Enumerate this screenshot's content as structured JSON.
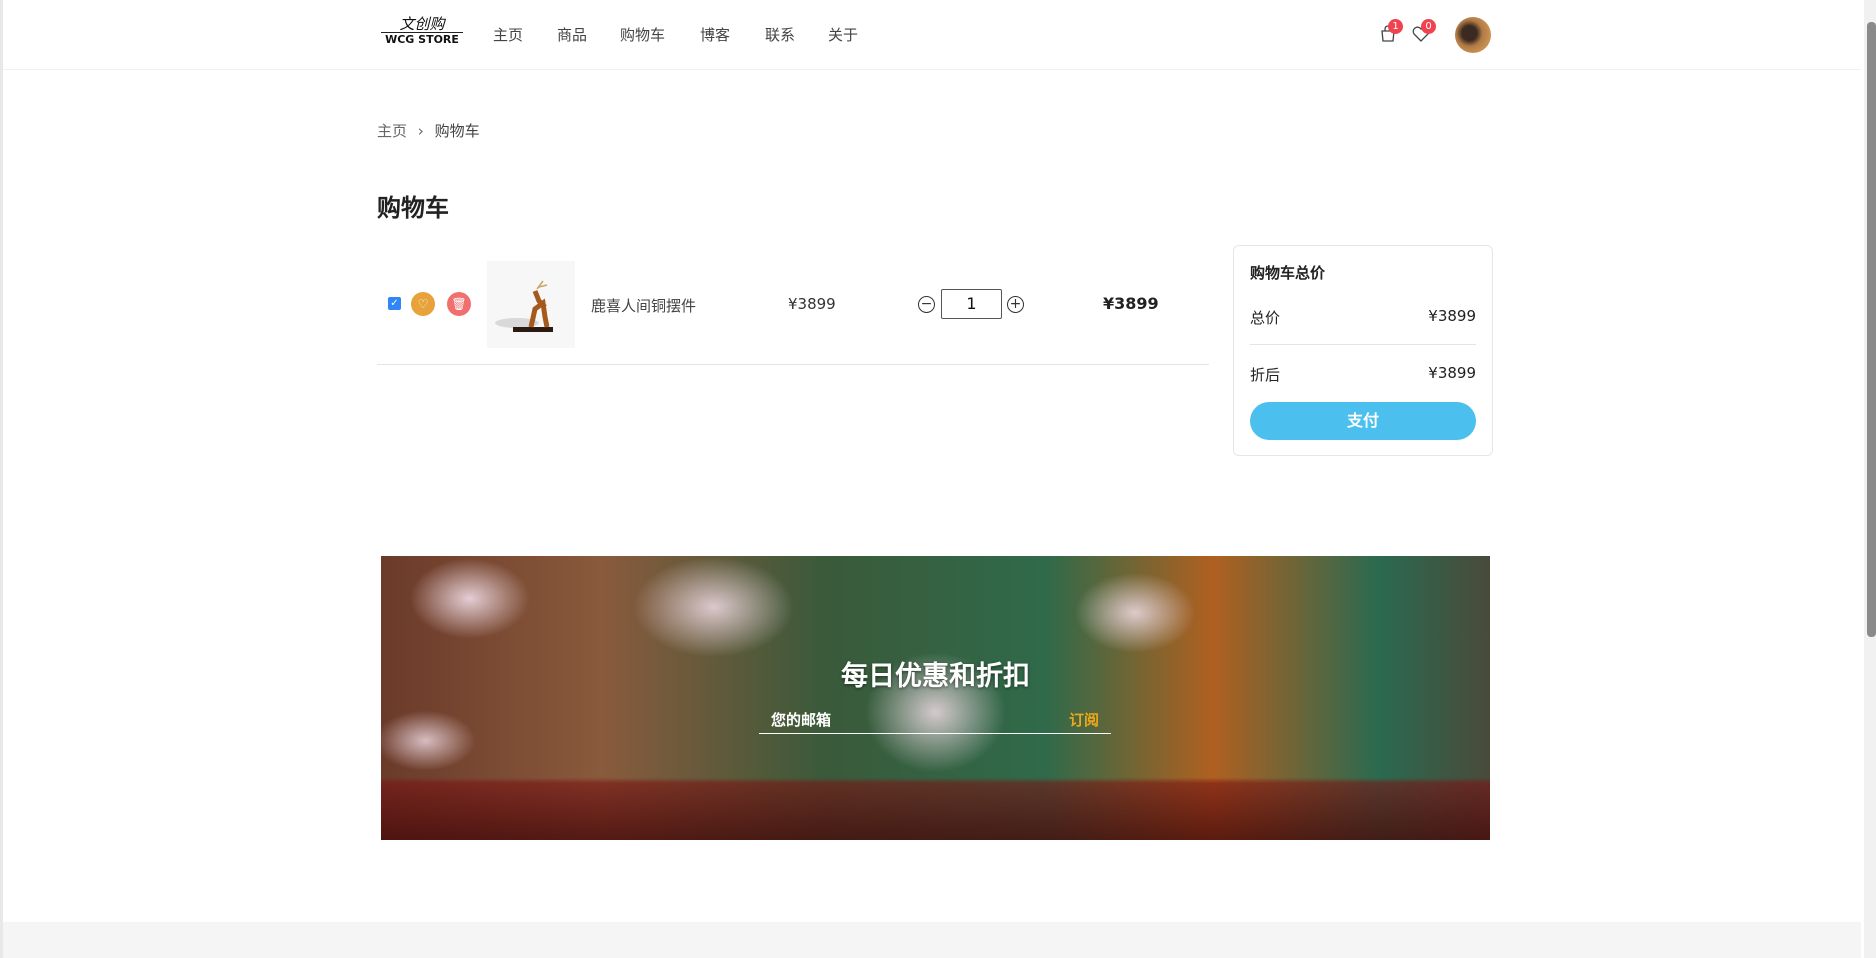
{
  "header": {
    "logo_cn": "文创购",
    "logo_en": "WCG STORE",
    "nav": [
      "主页",
      "商品",
      "购物车",
      "博客",
      "联系",
      "关于"
    ],
    "cart_count": "1",
    "wishlist_count": "0"
  },
  "breadcrumb": {
    "home": "主页",
    "current": "购物车"
  },
  "page_title": "购物车",
  "cart": {
    "items": [
      {
        "name": "鹿喜人间铜摆件",
        "price": "¥3899",
        "quantity": "1",
        "subtotal": "¥3899",
        "checked": true
      }
    ]
  },
  "summary": {
    "title": "购物车总价",
    "total_label": "总价",
    "total": "¥3899",
    "discount_label": "折后",
    "discounted": "¥3899",
    "pay": "支付"
  },
  "banner": {
    "title": "每日优惠和折扣",
    "email_placeholder": "您的邮箱",
    "subscribe": "订阅"
  },
  "colors": {
    "accent": "#4bbfee",
    "badge": "#f0434f",
    "subscribe": "#f0a818"
  }
}
